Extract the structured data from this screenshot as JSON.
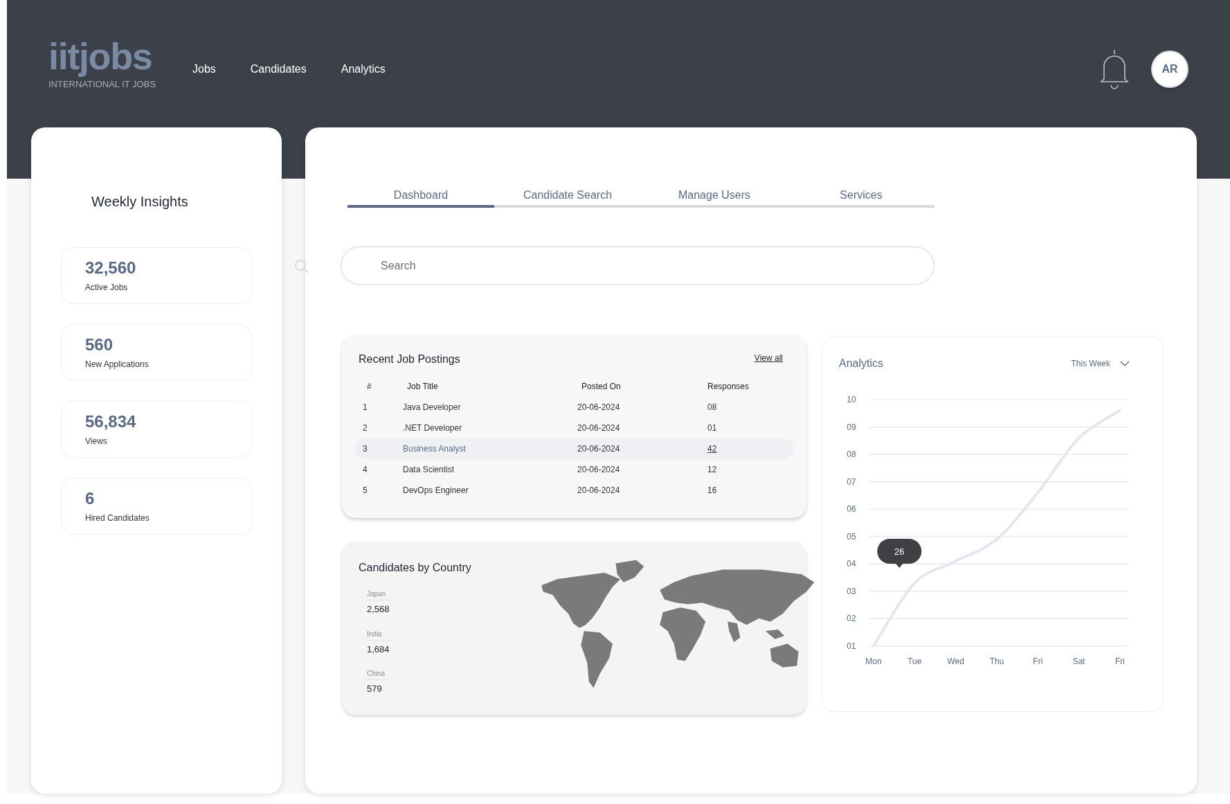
{
  "header": {
    "logo": "iitjobs",
    "tagline": "INTERNATIONAL IT JOBS",
    "nav": [
      {
        "label": "Jobs"
      },
      {
        "label": "Candidates"
      },
      {
        "label": "Analytics"
      }
    ],
    "avatar": "AR"
  },
  "insights": {
    "title": "Weekly Insights",
    "stats": [
      {
        "value": "32,560",
        "label": "Active Jobs"
      },
      {
        "value": "560",
        "label": "New Applications"
      },
      {
        "value": "56,834",
        "label": "Views"
      },
      {
        "value": "6",
        "label": "Hired Candidates"
      }
    ]
  },
  "tabs": [
    {
      "label": "Dashboard",
      "selected": true
    },
    {
      "label": "Candidate Search",
      "selected": false
    },
    {
      "label": "Manage Users",
      "selected": false
    },
    {
      "label": "Services",
      "selected": false
    }
  ],
  "search": {
    "placeholder": "Search"
  },
  "recent_postings": {
    "title": "Recent Job Postings",
    "view_all": "View all",
    "columns": [
      "#",
      "Job Title",
      "Posted On",
      "Responses"
    ],
    "rows": [
      {
        "cells": [
          "1",
          "Java Developer",
          "20-06-2024",
          "08"
        ],
        "selected": false
      },
      {
        "cells": [
          "2",
          ".NET Developer",
          "20-06-2024",
          "01"
        ],
        "selected": false
      },
      {
        "cells": [
          "3",
          "Business Analyst",
          "20-06-2024",
          "42"
        ],
        "selected": true
      },
      {
        "cells": [
          "4",
          "Data Scientist",
          "20-06-2024",
          "12"
        ],
        "selected": false
      },
      {
        "cells": [
          "5",
          "DevOps  Engineer",
          "20-06-2024",
          "16"
        ],
        "selected": false
      }
    ]
  },
  "candidates_by_country": {
    "title": "Candidates by Country",
    "countries": [
      {
        "name": "Japan",
        "value": "2,568"
      },
      {
        "name": "India",
        "value": "1,684"
      },
      {
        "name": "China",
        "value": "579"
      }
    ]
  },
  "analytics": {
    "title": "Analytics",
    "period": "This Week",
    "chart_data": {
      "type": "line",
      "categories": [
        "Mon",
        "Tue",
        "Wed",
        "Thu",
        "Fri",
        "Sat",
        "Fri"
      ],
      "grid": true,
      "series": [
        {
          "color": "#e3e8ef",
          "values": [
            1,
            3.3,
            4.1,
            4.9,
            6.6,
            8.6,
            9.6
          ]
        }
      ],
      "ylim": [
        1,
        10
      ],
      "yticks": [
        {
          "value": 1,
          "label": "01"
        },
        {
          "value": 2,
          "label": "02"
        },
        {
          "value": 3,
          "label": "03"
        },
        {
          "value": 4,
          "label": "04"
        },
        {
          "value": 5,
          "label": "05"
        },
        {
          "value": 6,
          "label": "06"
        },
        {
          "value": 7,
          "label": "07"
        },
        {
          "value": 8,
          "label": "08"
        },
        {
          "value": 9,
          "label": "09"
        },
        {
          "value": 10,
          "label": "10"
        }
      ],
      "annotations": [
        "26"
      ]
    }
  }
}
